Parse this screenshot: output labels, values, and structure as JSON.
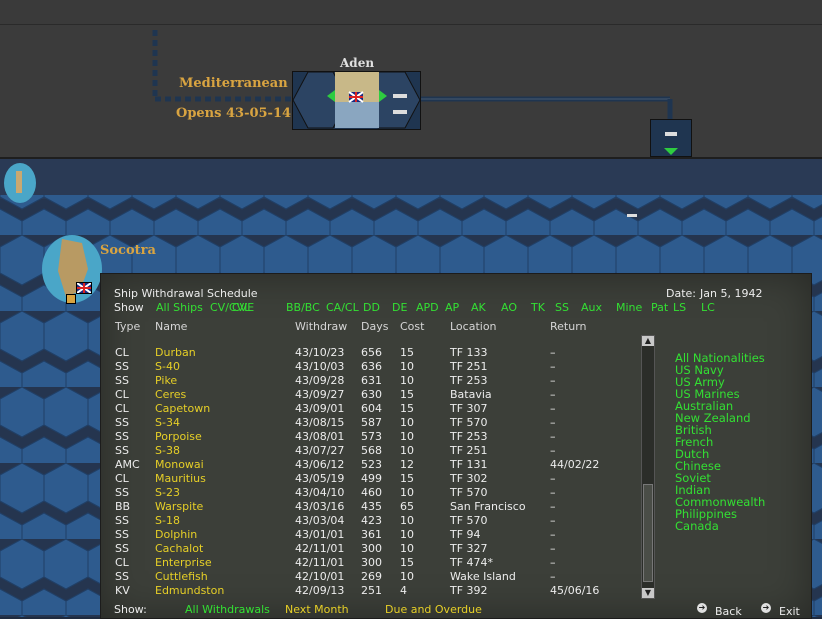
{
  "strip": {
    "left_name": "Mediterranean",
    "left_opens": "Opens 43-05-14",
    "base_name": "Aden"
  },
  "map": {
    "socotra_label": "Socotra"
  },
  "panel": {
    "title": "Ship Withdrawal Schedule",
    "date_label": "Date:",
    "date_value": "Jan 5, 1942",
    "show_label": "Show",
    "filters": [
      "All Ships",
      "CV/CVL",
      "CVE",
      "BB/BC",
      "CA/CL",
      "DD",
      "DE",
      "APD",
      "AP",
      "AK",
      "AO",
      "TK",
      "SS",
      "Aux",
      "Mine",
      "Pat",
      "LS",
      "LC"
    ],
    "columns": {
      "type": "Type",
      "name": "Name",
      "withdraw": "Withdraw",
      "days": "Days",
      "cost": "Cost",
      "location": "Location",
      "return": "Return"
    },
    "rows": [
      {
        "type": "CL",
        "name": "Durban",
        "withdraw": "43/10/23",
        "days": "656",
        "cost": "15",
        "location": "TF 133",
        "return": "–"
      },
      {
        "type": "SS",
        "name": "S-40",
        "withdraw": "43/10/03",
        "days": "636",
        "cost": "10",
        "location": "TF 251",
        "return": "–"
      },
      {
        "type": "SS",
        "name": "Pike",
        "withdraw": "43/09/28",
        "days": "631",
        "cost": "10",
        "location": "TF 253",
        "return": "–"
      },
      {
        "type": "CL",
        "name": "Ceres",
        "withdraw": "43/09/27",
        "days": "630",
        "cost": "15",
        "location": "Batavia",
        "return": "–"
      },
      {
        "type": "CL",
        "name": "Capetown",
        "withdraw": "43/09/01",
        "days": "604",
        "cost": "15",
        "location": "TF 307",
        "return": "–"
      },
      {
        "type": "SS",
        "name": "S-34",
        "withdraw": "43/08/15",
        "days": "587",
        "cost": "10",
        "location": "TF 570",
        "return": "–"
      },
      {
        "type": "SS",
        "name": "Porpoise",
        "withdraw": "43/08/01",
        "days": "573",
        "cost": "10",
        "location": "TF 253",
        "return": "–"
      },
      {
        "type": "SS",
        "name": "S-38",
        "withdraw": "43/07/27",
        "days": "568",
        "cost": "10",
        "location": "TF 251",
        "return": "–"
      },
      {
        "type": "AMC",
        "name": "Monowai",
        "withdraw": "43/06/12",
        "days": "523",
        "cost": "12",
        "location": "TF 131",
        "return": "44/02/22"
      },
      {
        "type": "CL",
        "name": "Mauritius",
        "withdraw": "43/05/19",
        "days": "499",
        "cost": "15",
        "location": "TF 302",
        "return": "–"
      },
      {
        "type": "SS",
        "name": "S-23",
        "withdraw": "43/04/10",
        "days": "460",
        "cost": "10",
        "location": "TF 570",
        "return": "–"
      },
      {
        "type": "BB",
        "name": "Warspite",
        "withdraw": "43/03/16",
        "days": "435",
        "cost": "65",
        "location": "San Francisco",
        "return": "–"
      },
      {
        "type": "SS",
        "name": "S-18",
        "withdraw": "43/03/04",
        "days": "423",
        "cost": "10",
        "location": "TF 570",
        "return": "–"
      },
      {
        "type": "SS",
        "name": "Dolphin",
        "withdraw": "43/01/01",
        "days": "361",
        "cost": "10",
        "location": "TF 94",
        "return": "–"
      },
      {
        "type": "SS",
        "name": "Cachalot",
        "withdraw": "42/11/01",
        "days": "300",
        "cost": "10",
        "location": "TF 327",
        "return": "–"
      },
      {
        "type": "CL",
        "name": "Enterprise",
        "withdraw": "42/11/01",
        "days": "300",
        "cost": "15",
        "location": "TF 474*",
        "return": "–"
      },
      {
        "type": "SS",
        "name": "Cuttlefish",
        "withdraw": "42/10/01",
        "days": "269",
        "cost": "10",
        "location": "Wake Island",
        "return": "–"
      },
      {
        "type": "KV",
        "name": "Edmundston",
        "withdraw": "42/09/13",
        "days": "251",
        "cost": "4",
        "location": "TF 392",
        "return": "45/06/16"
      }
    ],
    "nationalities": [
      "All Nationalities",
      "US Navy",
      "US Army",
      "US Marines",
      "Australian",
      "New Zealand",
      "British",
      "French",
      "Dutch",
      "Chinese",
      "Soviet",
      "Indian",
      "Commonwealth",
      "Philippines",
      "Canada"
    ],
    "bottom": {
      "show_label": "Show:",
      "all_withdrawals": "All Withdrawals",
      "next_month": "Next Month",
      "due_overdue": "Due and Overdue",
      "back": "Back",
      "exit": "Exit"
    }
  },
  "colors": {
    "accent_green": "#33e033",
    "name_yellow": "#e6cf27",
    "label_orange": "#d9a441"
  }
}
